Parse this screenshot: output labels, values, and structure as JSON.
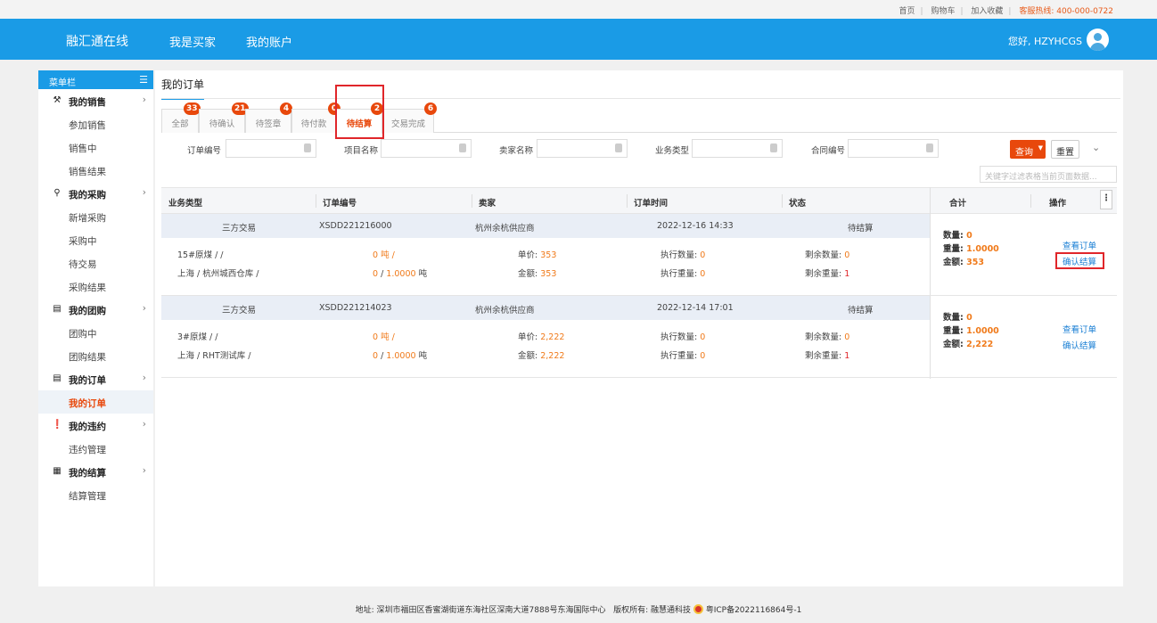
{
  "topbar": {
    "home": "首页",
    "cart": "购物车",
    "favorite": "加入收藏",
    "hotline": "客服热线: 400-000-0722"
  },
  "header": {
    "logo": "融汇通在线",
    "nav": [
      "我是买家",
      "我的账户"
    ],
    "greeting": "您好, HZYHCGS"
  },
  "sidebar": {
    "title": "菜单栏",
    "groups": [
      {
        "label": "我的销售",
        "items": [
          "参加销售",
          "销售中",
          "销售结果"
        ]
      },
      {
        "label": "我的采购",
        "items": [
          "新增采购",
          "采购中",
          "待交易",
          "采购结果"
        ]
      },
      {
        "label": "我的团购",
        "items": [
          "团购中",
          "团购结果"
        ]
      },
      {
        "label": "我的订单",
        "items": [
          "我的订单"
        ]
      },
      {
        "label": "我的违约",
        "items": [
          "违约管理"
        ]
      },
      {
        "label": "我的结算",
        "items": [
          "结算管理"
        ]
      }
    ]
  },
  "page": {
    "title": "我的订单"
  },
  "tabs": [
    {
      "label": "全部",
      "count": "33"
    },
    {
      "label": "待确认",
      "count": "21"
    },
    {
      "label": "待签章",
      "count": "4"
    },
    {
      "label": "待付款",
      "count": "0"
    },
    {
      "label": "待结算",
      "count": "2"
    },
    {
      "label": "交易完成",
      "count": "6"
    }
  ],
  "filters": {
    "order_no": "订单编号",
    "project": "项目名称",
    "seller": "卖家名称",
    "biz_type": "业务类型",
    "contract": "合同编号",
    "query": "查询",
    "reset": "重置",
    "keyword_placeholder": "关键字过滤表格当前页面数据..."
  },
  "table": {
    "headers": [
      "业务类型",
      "订单编号",
      "卖家",
      "订单时间",
      "状态",
      "合计",
      "操作"
    ],
    "orders": [
      {
        "type": "三方交易",
        "no": "XSDD221216000",
        "seller": "杭州余杭供应商",
        "time": "2022-12-16 14:33",
        "status": "待结算",
        "product": "15#原煤 / /",
        "qty_unit": "0 吨 /",
        "unit_price_label": "单价:",
        "unit_price": "353",
        "exec_qty_label": "执行数量:",
        "exec_qty": "0",
        "remain_qty_label": "剩余数量:",
        "remain_qty": "0",
        "location": "上海 / 杭州城西仓库 /",
        "weight_a": "0",
        "weight_b": "1.0000",
        "weight_unit": "吨",
        "amount_label": "金额:",
        "amount": "353",
        "exec_weight_label": "执行重量:",
        "exec_weight": "0",
        "remain_weight_label": "剩余重量:",
        "remain_weight": "1",
        "sum_qty_label": "数量:",
        "sum_qty": "0",
        "sum_weight_label": "重量:",
        "sum_weight": "1.0000",
        "sum_amount_label": "金额:",
        "sum_amount": "353",
        "op_view": "查看订单",
        "op_confirm": "确认结算"
      },
      {
        "type": "三方交易",
        "no": "XSDD221214023",
        "seller": "杭州余杭供应商",
        "time": "2022-12-14 17:01",
        "status": "待结算",
        "product": "3#原煤 / /",
        "qty_unit": "0 吨 /",
        "unit_price_label": "单价:",
        "unit_price": "2,222",
        "exec_qty_label": "执行数量:",
        "exec_qty": "0",
        "remain_qty_label": "剩余数量:",
        "remain_qty": "0",
        "location": "上海 / RHT测试库 /",
        "weight_a": "0",
        "weight_b": "1.0000",
        "weight_unit": "吨",
        "amount_label": "金额:",
        "amount": "2,222",
        "exec_weight_label": "执行重量:",
        "exec_weight": "0",
        "remain_weight_label": "剩余重量:",
        "remain_weight": "1",
        "sum_qty_label": "数量:",
        "sum_qty": "0",
        "sum_weight_label": "重量:",
        "sum_weight": "1.0000",
        "sum_amount_label": "金额:",
        "sum_amount": "2,222",
        "op_view": "查看订单",
        "op_confirm": "确认结算"
      }
    ]
  },
  "footer": {
    "address": "地址: 深圳市福田区香蜜湖街道东海社区深南大道7888号东海国际中心",
    "rights": "版权所有: 融慧通科技",
    "icp": "粤ICP备2022116864号-1"
  }
}
